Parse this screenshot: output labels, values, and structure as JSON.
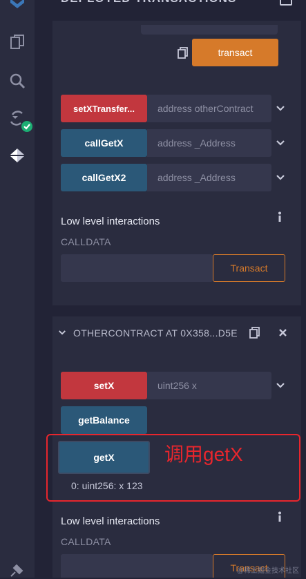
{
  "header": {
    "title": "DEPLOYED TRANSACTIONS"
  },
  "sidebar": {
    "icons": [
      "logo-icon",
      "file-explorer-icon",
      "search-icon",
      "compiler-icon",
      "deploy-run-icon",
      "plugin-icon"
    ]
  },
  "deployed": {
    "transact_label": "transact",
    "functions": [
      {
        "name": "setXTransfer...",
        "placeholder": "address otherContract",
        "kind": "payable"
      },
      {
        "name": "callGetX",
        "placeholder": "address _Address",
        "kind": "view"
      },
      {
        "name": "callGetX2",
        "placeholder": "address _Address",
        "kind": "view"
      }
    ],
    "low_level": {
      "title": "Low level interactions",
      "calldata_label": "CALLDATA",
      "transact_label": "Transact"
    }
  },
  "other_contract": {
    "title": "OTHERCONTRACT AT 0X358...D5E",
    "set_x": {
      "name": "setX",
      "placeholder": "uint256 x"
    },
    "get_balance": {
      "name": "getBalance"
    },
    "get_x": {
      "name": "getX",
      "result": "0: uint256: x 123"
    },
    "annotation": "调用getX",
    "low_level": {
      "title": "Low level interactions",
      "calldata_label": "CALLDATA",
      "transact_label": "Transact"
    }
  },
  "watermark": "@稀土掘金技术社区",
  "colors": {
    "accent_orange": "#d67a2a",
    "payable_red": "#c2373e",
    "view_blue": "#2b5878",
    "annotation_red": "#e8262d",
    "success_green": "#1cae73"
  }
}
